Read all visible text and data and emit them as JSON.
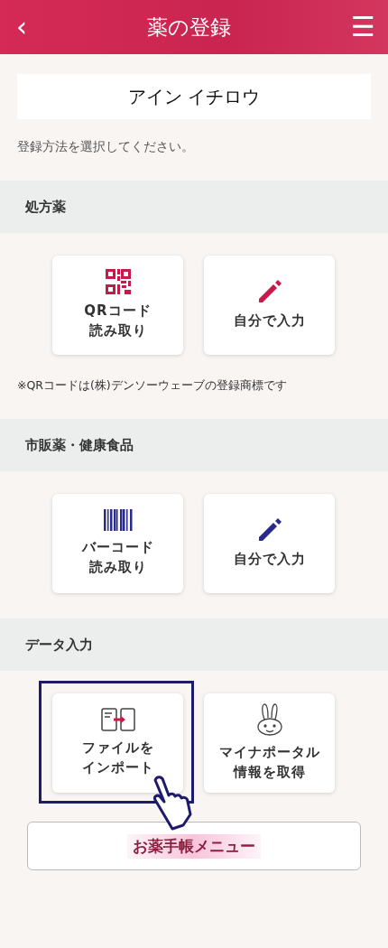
{
  "header": {
    "back": "‹",
    "title": "薬の登録",
    "menu": "☰"
  },
  "patient_name": "アイン イチロウ",
  "instruction": "登録方法を選択してください。",
  "sections": [
    {
      "kind": "prescription",
      "title": "処方薬",
      "cards": [
        {
          "kind": "qr",
          "lines": [
            "QRコード",
            "読み取り"
          ],
          "highlighted": false
        },
        {
          "kind": "pencil",
          "lines": [
            "自分で入力"
          ],
          "highlighted": false
        }
      ],
      "note": "※QRコードは(株)デンソーウェーブの登録商標です"
    },
    {
      "kind": "otc",
      "title": "市販薬・健康食品",
      "cards": [
        {
          "kind": "barcode",
          "lines": [
            "バーコード",
            "読み取り"
          ],
          "highlighted": false
        },
        {
          "kind": "pencil",
          "lines": [
            "自分で入力"
          ],
          "highlighted": false
        }
      ]
    },
    {
      "kind": "data",
      "title": "データ入力",
      "cards": [
        {
          "kind": "import",
          "lines": [
            "ファイルを",
            "インポート"
          ],
          "highlighted": true
        },
        {
          "kind": "rabbit",
          "lines": [
            "マイナポータル",
            "情報を取得"
          ],
          "highlighted": false
        }
      ]
    }
  ],
  "menu_button": "お薬手帳メニュー"
}
